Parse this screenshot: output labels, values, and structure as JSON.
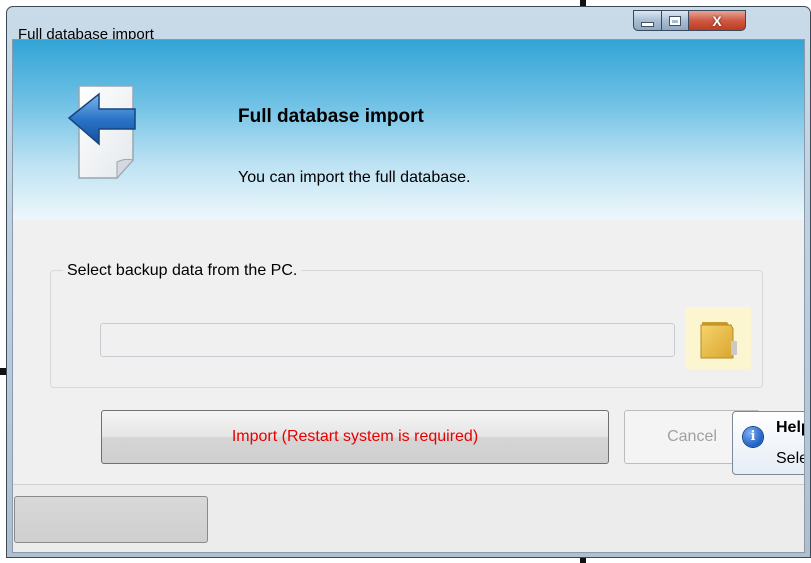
{
  "window": {
    "title": "Full database import",
    "close_glyph": "X"
  },
  "banner": {
    "icon": "import-arrow-document-icon",
    "title": "Full database import",
    "subtitle": "You can import the full database."
  },
  "backup_group": {
    "label": "Select backup data from the PC.",
    "path_value": "",
    "browse_icon": "folder-icon"
  },
  "buttons": {
    "import_label": "Import (Restart system is required)",
    "cancel_label": "Cancel"
  },
  "status_bar": {
    "button_label": ""
  },
  "help_tooltip": {
    "icon": "info-icon",
    "glyph": "i",
    "title": "Help",
    "body": "Select"
  },
  "colors": {
    "import_text": "#e60000",
    "banner_top": "#32a4d6",
    "close_button": "#c0391f"
  }
}
